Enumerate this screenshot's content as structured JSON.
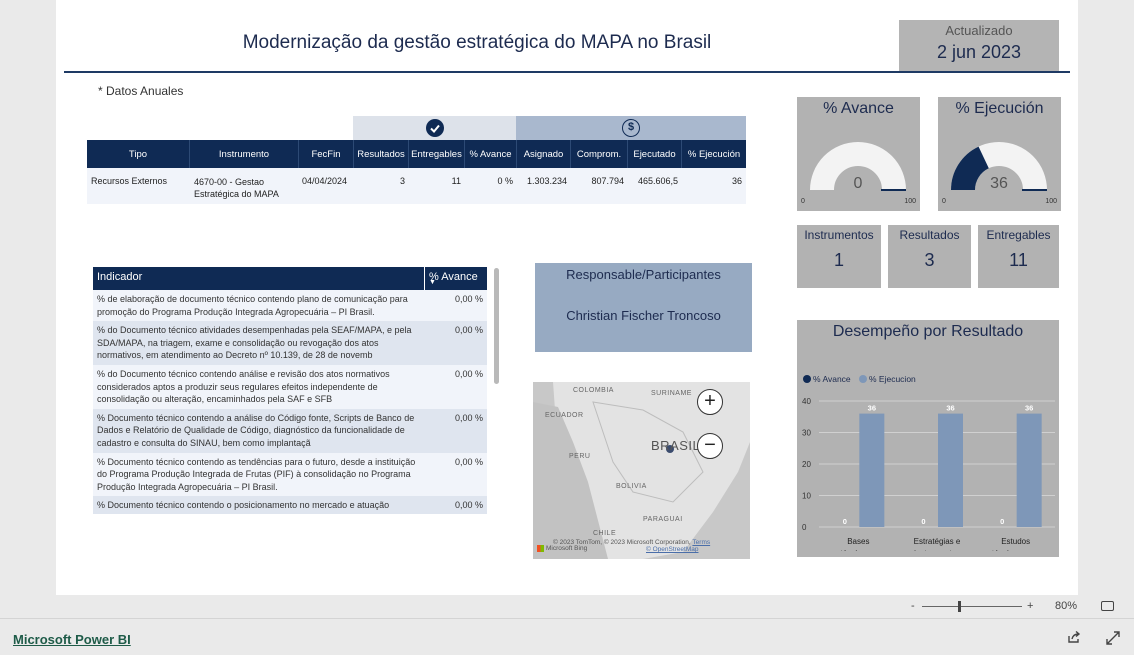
{
  "header": {
    "title": "Modernização da gestão estratégica do MAPA no Brasil",
    "updated_label": "Actualizado",
    "updated_date": "2 jun 2023",
    "note": "* Datos Anuales"
  },
  "top_table": {
    "columns": [
      "Tipo",
      "Instrumento",
      "FecFin",
      "Resultados",
      "Entregables",
      "% Avance",
      "Asignado",
      "Comprom.",
      "Ejecutado",
      "% Ejecución"
    ],
    "row": [
      "Recursos Externos",
      "4670-00 - Gestao Estratégica do MAPA",
      "04/04/2024",
      "3",
      "11",
      "0 %",
      "1.303.234",
      "807.794",
      "465.606,5",
      "36"
    ]
  },
  "indicators": {
    "header": {
      "label": "Indicador",
      "avance": "% Avance"
    },
    "rows": [
      {
        "text": "% de elaboração de documento técnico contendo plano de comunicação para promoção do Programa Produção Integrada Agropecuária – PI Brasil.",
        "value": "0,00 %"
      },
      {
        "text": "% do Documento técnico atividades desempenhadas pela SEAF/MAPA, e pela SDA/MAPA, na triagem, exame e consolidação ou revogação dos atos normativos, em atendimento ao Decreto nº 10.139, de 28 de novemb",
        "value": "0,00 %"
      },
      {
        "text": "% do Documento técnico contendo análise e revisão dos atos normativos considerados aptos a produzir seus regulares efeitos independente de consolidação ou alteração, encaminhados pela SAF e SFB",
        "value": "0,00 %"
      },
      {
        "text": "% Documento técnico contendo a análise do Código fonte, Scripts de Banco de Dados e Relatório de Qualidade de Código, diagnóstico da funcionalidade de cadastro e consulta do SINAU, bem como implantaçã",
        "value": "0,00 %"
      },
      {
        "text": "% Documento técnico contendo as tendências para o futuro, desde a instituição do Programa Produção Integrada de Frutas (PIF) à consolidação no Programa Produção Integrada Agropecuária – PI Brasil.",
        "value": "0,00 %"
      },
      {
        "text": "% Documento técnico contendo o posicionamento no mercado e atuação",
        "value": "0,00 %"
      }
    ]
  },
  "responsible": {
    "label": "Responsable/Participantes",
    "name": "Christian Fischer Troncoso"
  },
  "map": {
    "labels": {
      "colombia": "COLOMBIA",
      "suriname": "SURINAME",
      "ecuador": "ECUADOR",
      "peru": "PERU",
      "brasil": "BRASIL",
      "bolivia": "BOLIVIA",
      "paraguai": "PARAGUAI",
      "chile": "CHILE"
    },
    "copyright": "© 2023 TomTom, © 2023 Microsoft Corporation,",
    "terms": "Terms",
    "osm": "© OpenStreetMap",
    "bing": "Microsoft Bing",
    "zoom_in": "+",
    "zoom_out": "−"
  },
  "gauges": [
    {
      "title": "% Avance",
      "value": "0",
      "min": "0",
      "max": "100",
      "fill": 0.0
    },
    {
      "title": "% Ejecución",
      "value": "36",
      "min": "0",
      "max": "100",
      "fill": 0.36
    }
  ],
  "kpis": [
    {
      "label": "Instrumentos",
      "value": "1"
    },
    {
      "label": "Resultados",
      "value": "3"
    },
    {
      "label": "Entregables",
      "value": "11"
    }
  ],
  "colors": {
    "navy": "#0f2a54",
    "bar_blue": "#7e97b8",
    "card_gray": "#b2b2b2"
  },
  "chart_data": {
    "type": "bar",
    "title": "Desempeño por Resultado",
    "categories": [
      "Bases técnicas e científicas para harmoni...",
      "Estratégias e instrumentos de comunicaç...",
      "Estudos técnicos para concepção, i..."
    ],
    "series": [
      {
        "name": "% Avance",
        "color": "#0f2a54",
        "values": [
          0,
          0,
          0
        ]
      },
      {
        "name": "% Ejecucion",
        "color": "#7e97b8",
        "values": [
          36,
          36,
          36
        ]
      }
    ],
    "yticks": [
      "0",
      "10",
      "20",
      "30",
      "40"
    ],
    "ylim": [
      0,
      40
    ],
    "legend": "top-left"
  },
  "footer": {
    "zoom_minus": "-",
    "zoom_plus": "+",
    "zoom_level": "80%",
    "powerbi": "Microsoft Power BI"
  }
}
